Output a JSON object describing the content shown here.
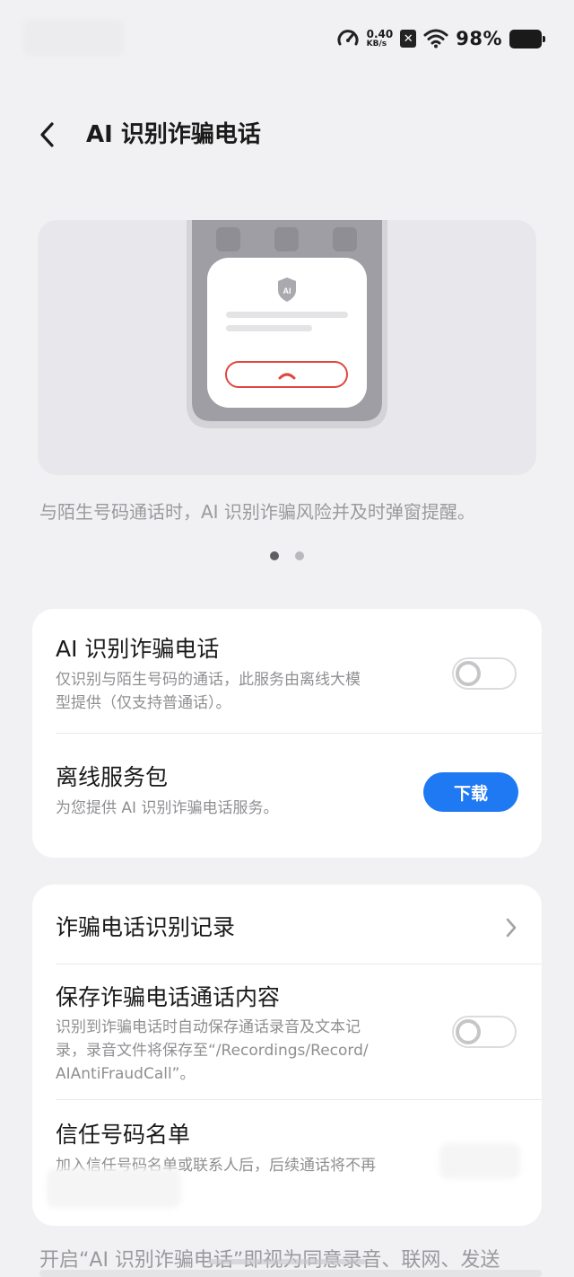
{
  "status_bar": {
    "net_speed_value": "0.40",
    "net_speed_unit": "KB/s",
    "battery": "98%",
    "icons": [
      "speedometer-icon",
      "x-badge-icon",
      "wifi-icon",
      "battery-icon"
    ]
  },
  "header": {
    "back_icon": "chevron-left-icon",
    "title": "AI 识别诈骗电话"
  },
  "illustration": {
    "badge_text": "AI",
    "caption": "与陌生号码通话时，AI 识别诈骗风险并及时弹窗提醒。",
    "pages": 2,
    "active_page": 1
  },
  "card1": {
    "ai_detect": {
      "title": "AI 识别诈骗电话",
      "desc_line1": "仅识别与陌生号码的通话，此服务由离线大模",
      "desc_line2": "型提供（仅支持普通话）。",
      "toggle_on": false
    },
    "offline_pack": {
      "title": "离线服务包",
      "desc": "为您提供 AI 识别诈骗电话服务。",
      "button_label": "下载"
    }
  },
  "card2": {
    "records": {
      "title": "诈骗电话识别记录",
      "icon": "chevron-right-icon"
    },
    "save_content": {
      "title": "保存诈骗电话通话内容",
      "desc_line1": "识别到诈骗电话时自动保存通话录音及文本记",
      "desc_line2": "录，录音文件将保存至“/Recordings/Record/",
      "desc_line3": "AIAntiFraudCall”。",
      "toggle_on": false
    },
    "trusted_list": {
      "title": "信任号码名单",
      "desc": "加入信任号码名单或联系人后，后续通话将不再"
    }
  },
  "footer": {
    "text": "开启“AI 识别诈骗电话”即视为同意录音、联网、发送"
  },
  "colors": {
    "background": "#f1f1f3",
    "accent": "#1f79f2",
    "alert_red": "#e0473f"
  }
}
